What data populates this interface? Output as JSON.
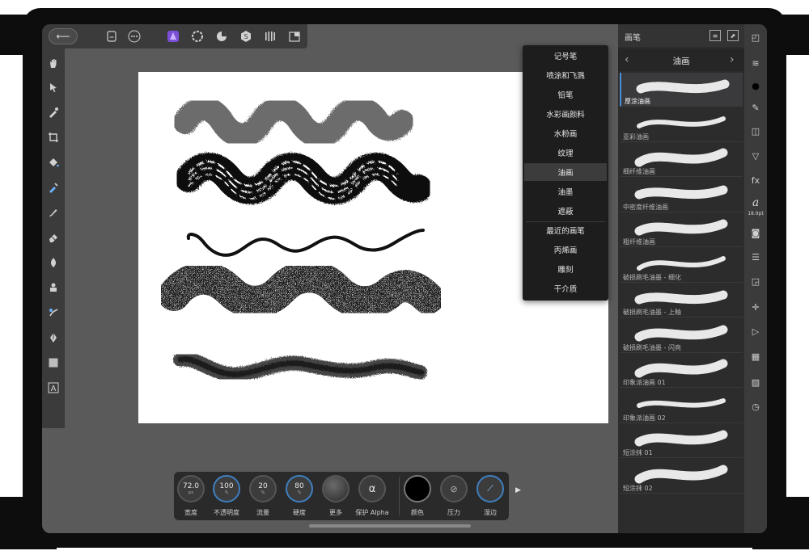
{
  "toolbar": {
    "back_icon": "arrow-left-icon",
    "document_icon": "document-icon",
    "more_icon": "more-icon",
    "personas": [
      "affinity-photo-persona-icon",
      "liquify-persona-icon",
      "develop-persona-icon",
      "tone-mapping-persona-icon",
      "export-persona-icon",
      "panels-icon"
    ]
  },
  "left_tools": [
    "hand-icon",
    "move-icon",
    "color-picker-icon",
    "crop-icon",
    "fill-icon",
    "selection-brush-icon",
    "paint-brush-icon",
    "erase-icon",
    "dodge-icon",
    "clone-icon",
    "healing-icon",
    "pen-icon",
    "shape-icon",
    "text-icon"
  ],
  "category_menu": {
    "items": [
      "记号笔",
      "喷涂和飞溅",
      "铅笔",
      "水彩画颜料",
      "水粉画",
      "纹理",
      "油画",
      "油墨",
      "遮蔽",
      "最近的画笔",
      "丙烯画",
      "雕刻",
      "干介质"
    ],
    "selected": "油画"
  },
  "brush_panel": {
    "title": "画笔",
    "category": "油画",
    "brushes": [
      {
        "name": "厚涂油画",
        "selected": true
      },
      {
        "name": "亚彩油画",
        "selected": false
      },
      {
        "name": "细纤维油画",
        "selected": false
      },
      {
        "name": "中密度纤维油画",
        "selected": false
      },
      {
        "name": "粗纤维油画",
        "selected": false
      },
      {
        "name": "破损刷毛油墨 - 细化",
        "selected": false
      },
      {
        "name": "破损刷毛油墨 - 上釉",
        "selected": false
      },
      {
        "name": "破损刷毛油墨 - 闪亮",
        "selected": false
      },
      {
        "name": "印象派油画 01",
        "selected": false
      },
      {
        "name": "印象派油画 02",
        "selected": false
      },
      {
        "name": "短涂抹 01",
        "selected": false
      },
      {
        "name": "短涂抹 02",
        "selected": false
      }
    ]
  },
  "right_tools": {
    "items": [
      "navigator-icon",
      "layers-icon",
      "colour-icon",
      "brushes-icon",
      "adjustments-icon",
      "channels-icon",
      "fx-icon",
      "character-icon",
      "snapshots-icon",
      "sliders-icon",
      "transform-icon",
      "navigator-target-icon",
      "play-icon",
      "grid-icon",
      "image-icon",
      "history-icon"
    ],
    "character_sub": "18.9pt"
  },
  "context": {
    "width": {
      "value": "72.0",
      "unit": "px",
      "label": "宽度"
    },
    "opacity": {
      "value": "100",
      "unit": "%",
      "label": "不透明度"
    },
    "flow": {
      "value": "20",
      "unit": "%",
      "label": "流量"
    },
    "hardness": {
      "value": "80",
      "unit": "%",
      "label": "硬度"
    },
    "more": {
      "label": "更多"
    },
    "protect_alpha": {
      "glyph": "α",
      "label": "保护 Alpha"
    },
    "colour": {
      "label": "颜色"
    },
    "pressure": {
      "label": "压力"
    },
    "wet_edges": {
      "label": "湿边"
    }
  }
}
